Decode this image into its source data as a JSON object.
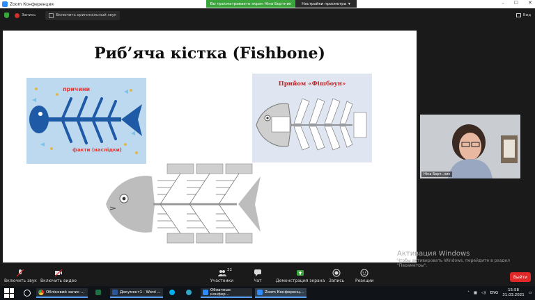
{
  "window": {
    "title": "Zoom Конференция",
    "share_banner": "Вы просматриваете экран Ніна Бортник",
    "view_options": "Настройки просмотра"
  },
  "topbar": {
    "recording": "Запись",
    "original_sound": "Включить оригинальный звук",
    "view": "Вид"
  },
  "slide": {
    "title": "Риб’яча кістка (Fishbone)",
    "left_pic": {
      "causes": "причини",
      "facts": "факти (наслідки)"
    },
    "right_pic": {
      "title": "Прийом «Фішбоун»"
    }
  },
  "video": {
    "name": "Ніна Борт..ник"
  },
  "watermark": {
    "line1": "Активация Windows",
    "line2": "Чтобы активировать Windows, перейдите в раздел \"Параметры\"."
  },
  "toolbar": {
    "unmute": "Включить звук",
    "start_video": "Включить видео",
    "participants": "Участники",
    "participants_count": "22",
    "chat": "Чат",
    "share_screen": "Демонстрация экрана",
    "record": "Запись",
    "reactions": "Реакции",
    "end": "Выйти"
  },
  "taskbar": {
    "tasks": [
      {
        "label": "Обліковий запис ..."
      },
      {
        "label": ""
      },
      {
        "label": "Документ1 - Word ..."
      },
      {
        "label": ""
      },
      {
        "label": ""
      },
      {
        "label": "Облачные конфер..."
      },
      {
        "label": "Zoom Конференц..."
      }
    ],
    "lang": "ENG",
    "time": "15:58",
    "date": "31.03.2021"
  },
  "colors": {
    "share_green": "#3aa53a",
    "end_red": "#e02828",
    "accent_blue": "#2d8cff"
  }
}
